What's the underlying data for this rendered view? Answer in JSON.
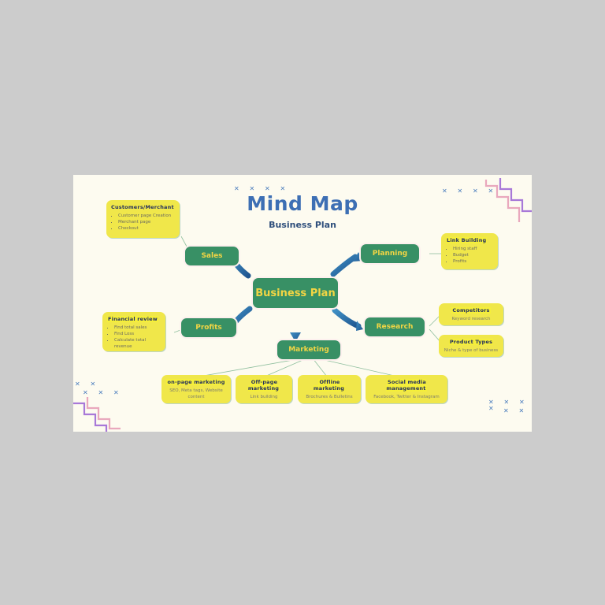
{
  "slide": {
    "title": "Mind Map",
    "subtitle": "Business Plan",
    "background": "#fdfbf0",
    "page_background": "#cccccc"
  },
  "colors": {
    "node_green": "#389065",
    "node_text": "#f2d544",
    "card_yellow": "#f0e74a",
    "card_header_text": "#24305e",
    "card_body_text": "#6b6b60",
    "title_blue": "#3d6fb4",
    "arrow_blue": "#2f6aa8",
    "decor_pink": "#e9a8bd",
    "decor_purple": "#a878d8",
    "connector_green": "#8fbf9e"
  },
  "center_node": {
    "label": "Business Plan"
  },
  "branches": [
    {
      "id": "sales",
      "label": "Sales"
    },
    {
      "id": "planning",
      "label": "Planning"
    },
    {
      "id": "profits",
      "label": "Profits"
    },
    {
      "id": "research",
      "label": "Research"
    },
    {
      "id": "marketing",
      "label": "Marketing"
    }
  ],
  "cards": {
    "customers": {
      "header": "Customers/Merchant",
      "items": [
        "Customer page Creation",
        "Merchant page",
        "Checkout"
      ]
    },
    "link_building": {
      "header": "Link Building",
      "items": [
        "Hiring staff",
        "Budget",
        "Profits"
      ]
    },
    "financial_review": {
      "header": "Financial review",
      "items": [
        "Find total sales",
        "Find Loss",
        "Calculate total revenue"
      ]
    },
    "competitors": {
      "header": "Competitors",
      "body": "Keyword research"
    },
    "product_types": {
      "header": "Product Types",
      "body": "Niche & type of business"
    },
    "on_page": {
      "header": "on-page marketing",
      "body": "SEO, Meta tags, Website content"
    },
    "off_page": {
      "header": "Off-page marketing",
      "body": "Link building"
    },
    "offline": {
      "header": "Offline marketing",
      "body": "Brochures & Bulletins"
    },
    "social": {
      "header": "Social media management",
      "body": "Facebook, Twitter & Instagram"
    }
  },
  "decorations": {
    "x_glyph": "✕",
    "x_clusters": [
      {
        "id": "title-top",
        "marks": 4
      },
      {
        "id": "top-right",
        "marks": 4
      },
      {
        "id": "bottom-left-top",
        "marks": 2
      },
      {
        "id": "bottom-left-bottom",
        "marks": 3
      },
      {
        "id": "bottom-right-top",
        "marks": 4
      },
      {
        "id": "bottom-right-bottom",
        "marks": 2
      }
    ]
  }
}
